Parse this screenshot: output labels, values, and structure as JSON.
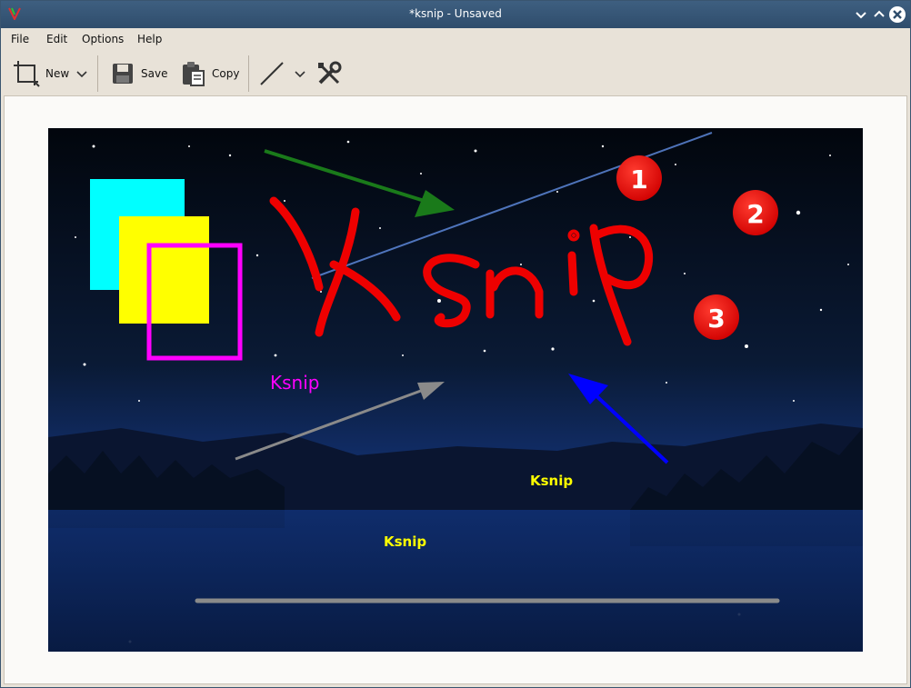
{
  "window": {
    "title": "*ksnip - Unsaved"
  },
  "menu": {
    "file": "File",
    "edit": "Edit",
    "options": "Options",
    "help": "Help"
  },
  "toolbar": {
    "new_label": "New",
    "save_label": "Save",
    "copy_label": "Copy"
  },
  "annotations": {
    "big_text": "Ksnip",
    "magenta_text": "Ksnip",
    "yellow_text_1": "Ksnip",
    "yellow_text_2": "Ksnip",
    "number_1": "1",
    "number_2": "2",
    "number_3": "3"
  },
  "colors": {
    "accent": "#ff0000",
    "cyan": "#00ffff",
    "yellow": "#ffff00",
    "magenta": "#ff00ff",
    "green_arrow": "#1a7a1a",
    "blue_arrow": "#0000ff",
    "gray_arrow": "#8a8a8a"
  }
}
